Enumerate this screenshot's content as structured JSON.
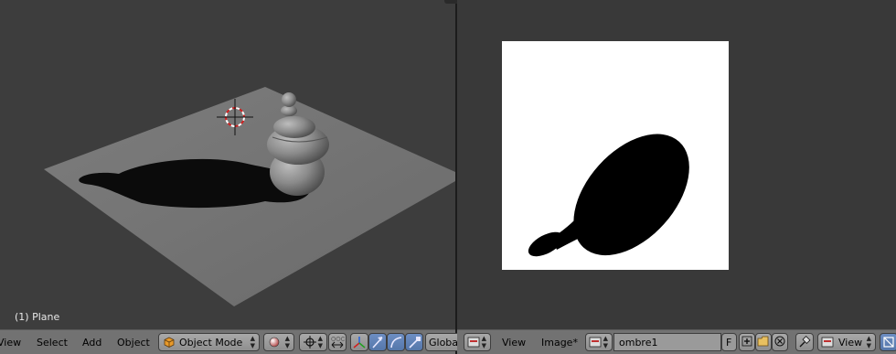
{
  "viewport": {
    "object_info": "(1) Plane"
  },
  "left_header": {
    "menus": [
      "View",
      "Select",
      "Add",
      "Object"
    ],
    "mode": "Object Mode",
    "orientation": "Global"
  },
  "right_header": {
    "menus": [
      "View",
      "Image*"
    ],
    "image_name": "ombre1",
    "fake_user": "F",
    "view_dropdown": "View"
  },
  "colors": {
    "header_bg": "#727272",
    "active_button": "#5577aa",
    "viewport_bg": "#3d3d3d"
  }
}
